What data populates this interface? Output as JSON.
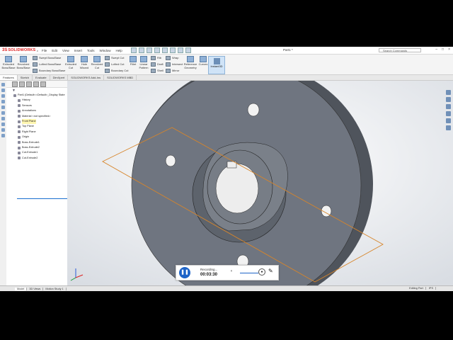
{
  "app": {
    "logo_ds": "3S",
    "logo_text": "SOLIDWORKS",
    "menu": [
      "File",
      "Edit",
      "View",
      "Insert",
      "Tools",
      "Window",
      "Help"
    ],
    "doc_title": "Part1 *",
    "search_placeholder": "Search Commands"
  },
  "ribbon": {
    "extruded_boss": "Extruded\nBoss/Base",
    "revolved_boss": "Revolved\nBoss/Base",
    "swept_boss": "Swept Boss/Base",
    "lofted_boss": "Lofted Boss/Base",
    "boundary_boss": "Boundary Boss/Base",
    "extruded_cut": "Extruded\nCut",
    "hole_wizard": "Hole\nWizard",
    "revolved_cut": "Revolved\nCut",
    "swept_cut": "Swept Cut",
    "lofted_cut": "Lofted Cut",
    "boundary_cut": "Boundary Cut",
    "fillet": "Fillet",
    "linear_pattern": "Linear\nPattern",
    "rib": "Rib",
    "draft": "Draft",
    "shell": "Shell",
    "wrap": "Wrap",
    "intersect": "Intersect",
    "mirror": "Mirror",
    "ref_geometry": "Reference\nGeometry",
    "curves": "Curves",
    "instant3d": "Instant3D"
  },
  "tabs": [
    "Features",
    "Sketch",
    "Evaluate",
    "DimXpert",
    "SOLIDWORKS Add-Ins",
    "SOLIDWORKS MBD"
  ],
  "tree": {
    "root": "Part1  (Default<<Default>_Display State",
    "items": [
      "History",
      "Sensors",
      "Annotations",
      "Material <not specified>",
      "Front Plane",
      "Top Plane",
      "Right Plane",
      "Origin",
      "Boss-Extrude1",
      "Boss-Extrude2",
      "Cut-Extrude1",
      "Cut-Extrude2"
    ]
  },
  "status_tabs": [
    "",
    "Model",
    "3D Views",
    "Motion Study 1"
  ],
  "status_right": [
    "Editing Part",
    "IPS"
  ],
  "recorder": {
    "label": "Recording...",
    "time": "00:03:30"
  },
  "colors": {
    "background": "#000000",
    "part_face": "#6f7580",
    "plane_outline": "#d7852a",
    "accent": "#1e64c8"
  }
}
